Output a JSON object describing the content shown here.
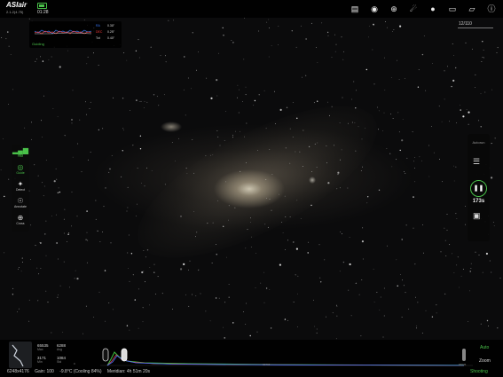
{
  "app": {
    "brand": "ASIair",
    "version": "2.1.2(4.75)",
    "time": "01:28"
  },
  "top_icons": [
    "wifi-icon",
    "camera-icon",
    "crosshair-icon",
    "telescope-icon",
    "filter-wheel-icon",
    "guide-icon",
    "focuser-icon",
    "info-icon"
  ],
  "frame_counter": "12/110",
  "guide_graph": {
    "rows": [
      {
        "label": "RA",
        "value": "0.30\"",
        "color": "#3b7bff"
      },
      {
        "label": "DEC",
        "value": "0.25\"",
        "color": "#ff3b3b"
      },
      {
        "label": "Tot",
        "value": "0.40\"",
        "color": "#dddddd"
      }
    ],
    "status": "Guiding"
  },
  "left_panel": [
    {
      "label": "Hist",
      "icon": "histogram-icon"
    },
    {
      "label": "Guide",
      "icon": "guide-target-icon"
    },
    {
      "label": "Detect",
      "icon": "detect-stars-icon"
    },
    {
      "label": "Annotate",
      "icon": "annotate-icon"
    },
    {
      "label": "Cross",
      "icon": "crosshair-icon"
    }
  ],
  "right_panel": {
    "mode": "Autorun",
    "exposure_remaining": "173s",
    "pause_icon": "pause-icon",
    "list_icon": "list-icon",
    "gallery_icon": "gallery-icon"
  },
  "stats": {
    "max": "65535",
    "avg": "6288",
    "min": "3171",
    "std": "1084",
    "labels": {
      "max": "Max",
      "avg": "Avg",
      "min": "Min",
      "std": "Std"
    }
  },
  "histogram": {
    "left_value": "0",
    "mid_value": "32768",
    "right_value": "65535"
  },
  "histogram_controls": {
    "auto": "Auto",
    "zoom": "Zoom"
  },
  "status_bar": {
    "resolution": "6248x4176",
    "gain": "Gain: 100",
    "temperature": "-9.8°C (Cooling 84%)",
    "meridian": "Meridian: 4h 51m 20s",
    "state": "Shooting"
  },
  "colors": {
    "accent": "#4ac14a",
    "ra": "#3b7bff",
    "dec": "#ff3b3b"
  }
}
